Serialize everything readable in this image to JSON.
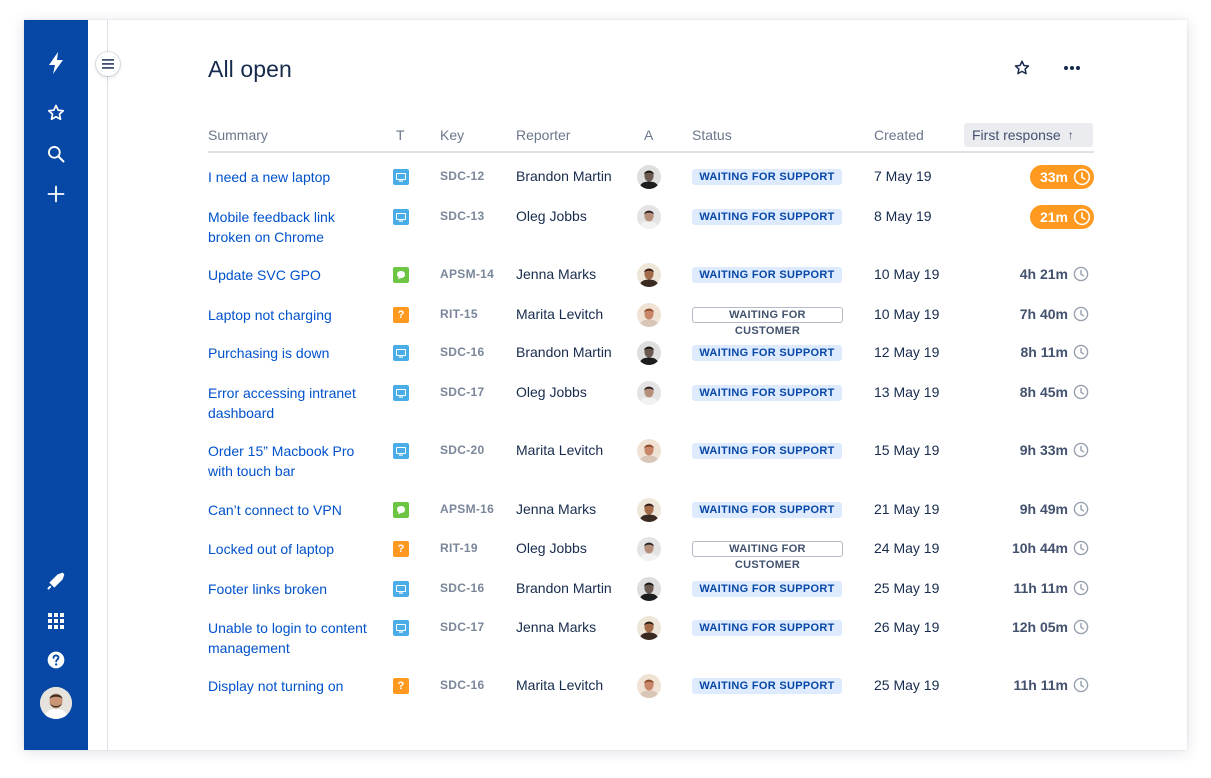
{
  "page": {
    "title": "All open"
  },
  "nav": {
    "top_icons": [
      "jira-logo-icon",
      "star-icon",
      "search-icon",
      "plus-icon"
    ],
    "bottom_icons": [
      "megaphone-icon",
      "app-switcher-icon",
      "help-icon",
      "avatar"
    ]
  },
  "columns": {
    "summary": "Summary",
    "type": "T",
    "key": "Key",
    "reporter": "Reporter",
    "assignee": "A",
    "status": "Status",
    "created": "Created",
    "first_response": "First response",
    "sort_arrow": "↑"
  },
  "colors": {
    "nav": "#0747a6",
    "link": "#0052cc",
    "urgent": "#ff991f",
    "support_badge_bg": "#deebff",
    "support_badge_fg": "#0747a6",
    "type_blue": "#4bade8",
    "type_green": "#6cc644",
    "type_orange": "#ff991f"
  },
  "rows": [
    {
      "summary": "I need a new laptop",
      "type": "desktop",
      "key": "SDC-12",
      "reporter": "Brandon Martin",
      "assignee": "brandon",
      "status": "WAITING FOR SUPPORT",
      "status_kind": "support",
      "created": "7 May 19",
      "first_response": "33m",
      "urgent": true
    },
    {
      "summary": "Mobile feedback link broken on Chrome",
      "type": "desktop",
      "key": "SDC-13",
      "reporter": "Oleg Jobbs",
      "assignee": "oleg",
      "status": "WAITING FOR SUPPORT",
      "status_kind": "support",
      "created": "8 May 19",
      "first_response": "21m",
      "urgent": true
    },
    {
      "summary": "Update SVC GPO",
      "type": "chat",
      "key": "APSM-14",
      "reporter": "Jenna Marks",
      "assignee": "jenna",
      "status": "WAITING FOR SUPPORT",
      "status_kind": "support",
      "created": "10 May 19",
      "first_response": "4h 21m",
      "urgent": false
    },
    {
      "summary": "Laptop not charging",
      "type": "question",
      "key": "RIT-15",
      "reporter": "Marita Levitch",
      "assignee": "marita",
      "status": "WAITING FOR CUSTOMER",
      "status_kind": "customer",
      "created": "10 May 19",
      "first_response": "7h 40m",
      "urgent": false
    },
    {
      "summary": "Purchasing is down",
      "type": "desktop",
      "key": "SDC-16",
      "reporter": "Brandon Martin",
      "assignee": "brandon",
      "status": "WAITING FOR SUPPORT",
      "status_kind": "support",
      "created": "12 May 19",
      "first_response": "8h 11m",
      "urgent": false
    },
    {
      "summary": "Error accessing intranet dashboard",
      "type": "desktop",
      "key": "SDC-17",
      "reporter": "Oleg Jobbs",
      "assignee": "oleg",
      "status": "WAITING FOR SUPPORT",
      "status_kind": "support",
      "created": "13 May 19",
      "first_response": "8h 45m",
      "urgent": false
    },
    {
      "summary": "Order 15” Macbook Pro with touch bar",
      "type": "desktop",
      "key": "SDC-20",
      "reporter": "Marita Levitch",
      "assignee": "marita",
      "status": "WAITING FOR SUPPORT",
      "status_kind": "support",
      "created": "15 May 19",
      "first_response": "9h 33m",
      "urgent": false
    },
    {
      "summary": "Can’t connect to VPN",
      "type": "chat",
      "key": "APSM-16",
      "reporter": "Jenna Marks",
      "assignee": "jenna",
      "status": "WAITING FOR SUPPORT",
      "status_kind": "support",
      "created": "21 May 19",
      "first_response": "9h 49m",
      "urgent": false
    },
    {
      "summary": "Locked out of laptop",
      "type": "question",
      "key": "RIT-19",
      "reporter": "Oleg Jobbs",
      "assignee": "oleg",
      "status": "WAITING FOR CUSTOMER",
      "status_kind": "customer",
      "created": "24 May 19",
      "first_response": "10h 44m",
      "urgent": false
    },
    {
      "summary": "Footer links broken",
      "type": "desktop",
      "key": "SDC-16",
      "reporter": "Brandon Martin",
      "assignee": "brandon",
      "status": "WAITING FOR SUPPORT",
      "status_kind": "support",
      "created": "25 May 19",
      "first_response": "11h 11m",
      "urgent": false
    },
    {
      "summary": "Unable to login to content management",
      "type": "desktop",
      "key": "SDC-17",
      "reporter": "Jenna Marks",
      "assignee": "jenna",
      "status": "WAITING FOR SUPPORT",
      "status_kind": "support",
      "created": "26 May 19",
      "first_response": "12h 05m",
      "urgent": false
    },
    {
      "summary": "Display not turning on",
      "type": "question",
      "key": "SDC-16",
      "reporter": "Marita Levitch",
      "assignee": "marita",
      "status": "WAITING FOR SUPPORT",
      "status_kind": "support",
      "created": "25 May 19",
      "first_response": "11h 11m",
      "urgent": false
    }
  ]
}
